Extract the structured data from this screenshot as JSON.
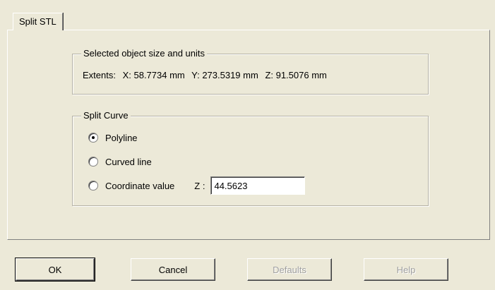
{
  "tab": {
    "label": "Split STL"
  },
  "size_group": {
    "title": "Selected object size and units",
    "extents_label": "Extents:",
    "x": "X: 58.7734 mm",
    "y": "Y: 273.5319 mm",
    "z": "Z: 91.5076 mm"
  },
  "curve_group": {
    "title": "Split Curve",
    "options": [
      {
        "label": "Polyline",
        "checked": true
      },
      {
        "label": "Curved line",
        "checked": false
      },
      {
        "label": "Coordinate value",
        "checked": false
      }
    ],
    "z_label": "Z :",
    "z_value": "44.5623"
  },
  "buttons": {
    "ok": "OK",
    "cancel": "Cancel",
    "defaults": "Defaults",
    "help": "Help"
  }
}
